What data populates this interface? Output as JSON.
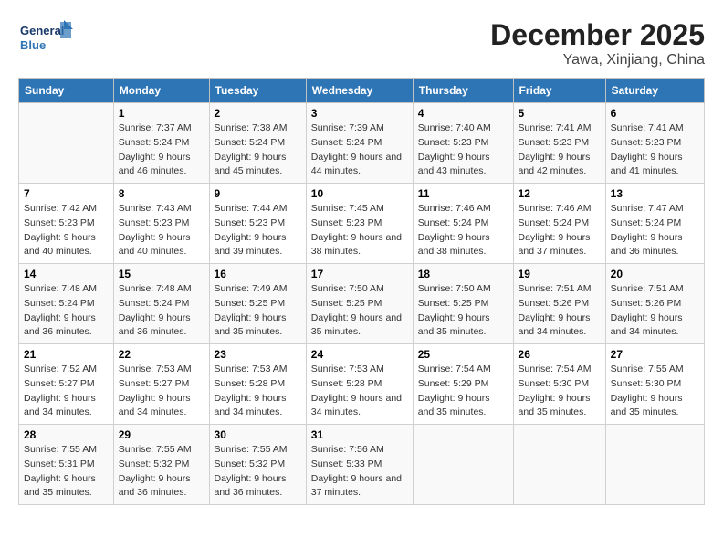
{
  "logo": {
    "line1": "General",
    "line2": "Blue"
  },
  "title": "December 2025",
  "subtitle": "Yawa, Xinjiang, China",
  "days_of_week": [
    "Sunday",
    "Monday",
    "Tuesday",
    "Wednesday",
    "Thursday",
    "Friday",
    "Saturday"
  ],
  "weeks": [
    [
      {
        "day": "",
        "sunrise": "",
        "sunset": "",
        "daylight": ""
      },
      {
        "day": "1",
        "sunrise": "Sunrise: 7:37 AM",
        "sunset": "Sunset: 5:24 PM",
        "daylight": "Daylight: 9 hours and 46 minutes."
      },
      {
        "day": "2",
        "sunrise": "Sunrise: 7:38 AM",
        "sunset": "Sunset: 5:24 PM",
        "daylight": "Daylight: 9 hours and 45 minutes."
      },
      {
        "day": "3",
        "sunrise": "Sunrise: 7:39 AM",
        "sunset": "Sunset: 5:24 PM",
        "daylight": "Daylight: 9 hours and 44 minutes."
      },
      {
        "day": "4",
        "sunrise": "Sunrise: 7:40 AM",
        "sunset": "Sunset: 5:23 PM",
        "daylight": "Daylight: 9 hours and 43 minutes."
      },
      {
        "day": "5",
        "sunrise": "Sunrise: 7:41 AM",
        "sunset": "Sunset: 5:23 PM",
        "daylight": "Daylight: 9 hours and 42 minutes."
      },
      {
        "day": "6",
        "sunrise": "Sunrise: 7:41 AM",
        "sunset": "Sunset: 5:23 PM",
        "daylight": "Daylight: 9 hours and 41 minutes."
      }
    ],
    [
      {
        "day": "7",
        "sunrise": "Sunrise: 7:42 AM",
        "sunset": "Sunset: 5:23 PM",
        "daylight": "Daylight: 9 hours and 40 minutes."
      },
      {
        "day": "8",
        "sunrise": "Sunrise: 7:43 AM",
        "sunset": "Sunset: 5:23 PM",
        "daylight": "Daylight: 9 hours and 40 minutes."
      },
      {
        "day": "9",
        "sunrise": "Sunrise: 7:44 AM",
        "sunset": "Sunset: 5:23 PM",
        "daylight": "Daylight: 9 hours and 39 minutes."
      },
      {
        "day": "10",
        "sunrise": "Sunrise: 7:45 AM",
        "sunset": "Sunset: 5:23 PM",
        "daylight": "Daylight: 9 hours and 38 minutes."
      },
      {
        "day": "11",
        "sunrise": "Sunrise: 7:46 AM",
        "sunset": "Sunset: 5:24 PM",
        "daylight": "Daylight: 9 hours and 38 minutes."
      },
      {
        "day": "12",
        "sunrise": "Sunrise: 7:46 AM",
        "sunset": "Sunset: 5:24 PM",
        "daylight": "Daylight: 9 hours and 37 minutes."
      },
      {
        "day": "13",
        "sunrise": "Sunrise: 7:47 AM",
        "sunset": "Sunset: 5:24 PM",
        "daylight": "Daylight: 9 hours and 36 minutes."
      }
    ],
    [
      {
        "day": "14",
        "sunrise": "Sunrise: 7:48 AM",
        "sunset": "Sunset: 5:24 PM",
        "daylight": "Daylight: 9 hours and 36 minutes."
      },
      {
        "day": "15",
        "sunrise": "Sunrise: 7:48 AM",
        "sunset": "Sunset: 5:24 PM",
        "daylight": "Daylight: 9 hours and 36 minutes."
      },
      {
        "day": "16",
        "sunrise": "Sunrise: 7:49 AM",
        "sunset": "Sunset: 5:25 PM",
        "daylight": "Daylight: 9 hours and 35 minutes."
      },
      {
        "day": "17",
        "sunrise": "Sunrise: 7:50 AM",
        "sunset": "Sunset: 5:25 PM",
        "daylight": "Daylight: 9 hours and 35 minutes."
      },
      {
        "day": "18",
        "sunrise": "Sunrise: 7:50 AM",
        "sunset": "Sunset: 5:25 PM",
        "daylight": "Daylight: 9 hours and 35 minutes."
      },
      {
        "day": "19",
        "sunrise": "Sunrise: 7:51 AM",
        "sunset": "Sunset: 5:26 PM",
        "daylight": "Daylight: 9 hours and 34 minutes."
      },
      {
        "day": "20",
        "sunrise": "Sunrise: 7:51 AM",
        "sunset": "Sunset: 5:26 PM",
        "daylight": "Daylight: 9 hours and 34 minutes."
      }
    ],
    [
      {
        "day": "21",
        "sunrise": "Sunrise: 7:52 AM",
        "sunset": "Sunset: 5:27 PM",
        "daylight": "Daylight: 9 hours and 34 minutes."
      },
      {
        "day": "22",
        "sunrise": "Sunrise: 7:53 AM",
        "sunset": "Sunset: 5:27 PM",
        "daylight": "Daylight: 9 hours and 34 minutes."
      },
      {
        "day": "23",
        "sunrise": "Sunrise: 7:53 AM",
        "sunset": "Sunset: 5:28 PM",
        "daylight": "Daylight: 9 hours and 34 minutes."
      },
      {
        "day": "24",
        "sunrise": "Sunrise: 7:53 AM",
        "sunset": "Sunset: 5:28 PM",
        "daylight": "Daylight: 9 hours and 34 minutes."
      },
      {
        "day": "25",
        "sunrise": "Sunrise: 7:54 AM",
        "sunset": "Sunset: 5:29 PM",
        "daylight": "Daylight: 9 hours and 35 minutes."
      },
      {
        "day": "26",
        "sunrise": "Sunrise: 7:54 AM",
        "sunset": "Sunset: 5:30 PM",
        "daylight": "Daylight: 9 hours and 35 minutes."
      },
      {
        "day": "27",
        "sunrise": "Sunrise: 7:55 AM",
        "sunset": "Sunset: 5:30 PM",
        "daylight": "Daylight: 9 hours and 35 minutes."
      }
    ],
    [
      {
        "day": "28",
        "sunrise": "Sunrise: 7:55 AM",
        "sunset": "Sunset: 5:31 PM",
        "daylight": "Daylight: 9 hours and 35 minutes."
      },
      {
        "day": "29",
        "sunrise": "Sunrise: 7:55 AM",
        "sunset": "Sunset: 5:32 PM",
        "daylight": "Daylight: 9 hours and 36 minutes."
      },
      {
        "day": "30",
        "sunrise": "Sunrise: 7:55 AM",
        "sunset": "Sunset: 5:32 PM",
        "daylight": "Daylight: 9 hours and 36 minutes."
      },
      {
        "day": "31",
        "sunrise": "Sunrise: 7:56 AM",
        "sunset": "Sunset: 5:33 PM",
        "daylight": "Daylight: 9 hours and 37 minutes."
      },
      {
        "day": "",
        "sunrise": "",
        "sunset": "",
        "daylight": ""
      },
      {
        "day": "",
        "sunrise": "",
        "sunset": "",
        "daylight": ""
      },
      {
        "day": "",
        "sunrise": "",
        "sunset": "",
        "daylight": ""
      }
    ]
  ]
}
